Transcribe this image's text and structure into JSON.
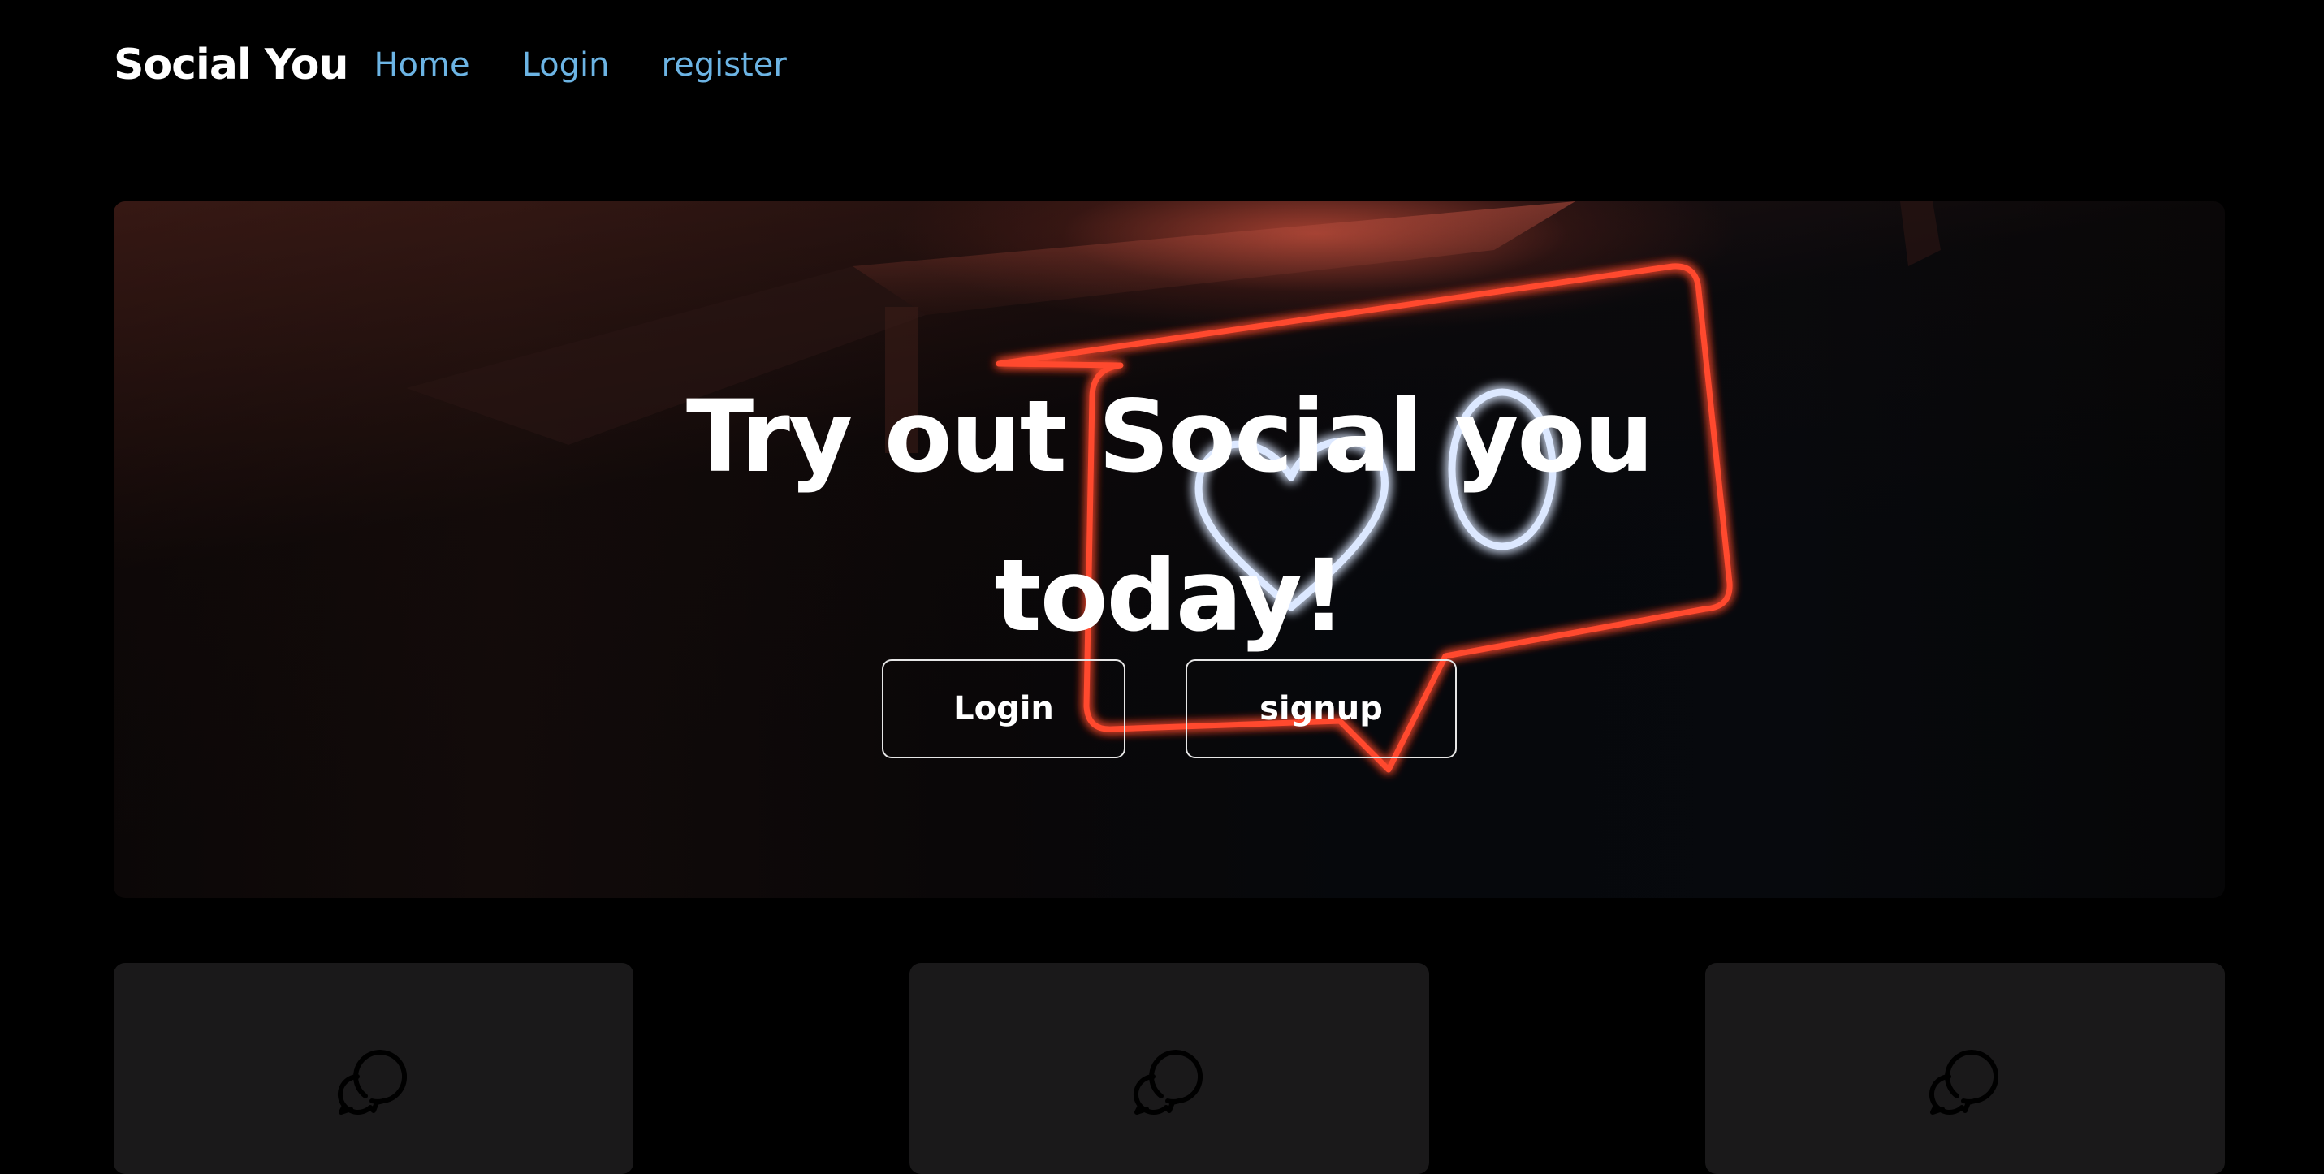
{
  "navbar": {
    "brand": "Social You",
    "links": [
      {
        "label": "Home"
      },
      {
        "label": "Login"
      },
      {
        "label": "register"
      }
    ]
  },
  "hero": {
    "title_line1": "Try out Social you",
    "title_line2": "today!",
    "login_button": "Login",
    "signup_button": "signup"
  },
  "cards": [
    {
      "icon": "chat-bubbles-icon"
    },
    {
      "icon": "chat-bubbles-icon"
    },
    {
      "icon": "chat-bubbles-icon"
    }
  ],
  "colors": {
    "background": "#000000",
    "nav_link": "#6cb4e4",
    "card_background": "#1a191a",
    "neon_red": "#ff4a2e",
    "neon_white": "#dce8ff"
  }
}
